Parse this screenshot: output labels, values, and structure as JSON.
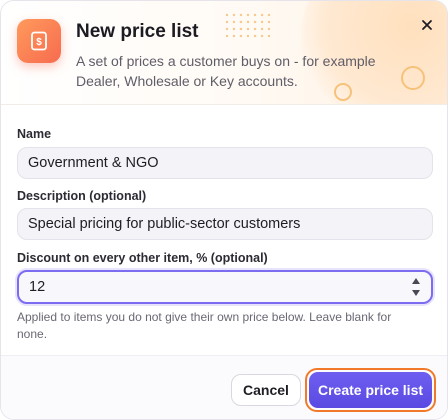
{
  "dialog": {
    "title": "New price list",
    "subtitle": "A set of prices a customer buys on - for example Dealer, Wholesale or Key accounts."
  },
  "form": {
    "name": {
      "label": "Name",
      "value": "Government & NGO"
    },
    "description": {
      "label": "Description (optional)",
      "value": "Special pricing for public-sector customers"
    },
    "discount": {
      "label": "Discount on every other item, % (optional)",
      "value": "12",
      "help": "Applied to items you do not give their own price below. Leave blank for none."
    }
  },
  "footer": {
    "cancel_label": "Cancel",
    "create_label": "Create price list"
  },
  "colors": {
    "accent": "#5b4ae2",
    "icon_gradient": "#f76b4f",
    "focus_ring": "#f07a2a"
  },
  "icons": {
    "app": "price-tag-icon",
    "close": "close-icon",
    "stepper": "stepper-arrows-icon"
  }
}
